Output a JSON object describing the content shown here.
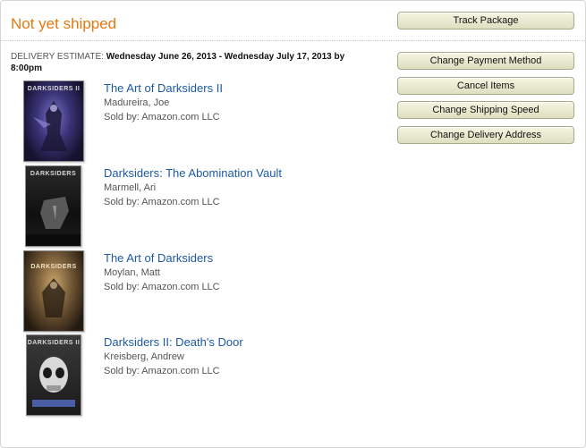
{
  "shipment": {
    "status": "Not yet shipped",
    "estimate_label": "DELIVERY ESTIMATE:",
    "estimate_dates": "Wednesday June 26, 2013 - Wednesday July 17, 2013 by 8:00pm"
  },
  "actions": {
    "track_package": "Track Package",
    "change_payment": "Change Payment Method",
    "cancel_items": "Cancel Items",
    "change_shipping_speed": "Change Shipping Speed",
    "change_delivery_address": "Change Delivery Address"
  },
  "items": [
    {
      "title": "The Art of Darksiders II",
      "author": "Madureira, Joe",
      "seller": "Sold by: Amazon.com LLC",
      "cover_text": "DARKSIDERS II"
    },
    {
      "title": "Darksiders: The Abomination Vault",
      "author": "Marmell, Ari",
      "seller": "Sold by: Amazon.com LLC",
      "cover_text": "DARKSIDERS"
    },
    {
      "title": "The Art of Darksiders",
      "author": "Moylan, Matt",
      "seller": "Sold by: Amazon.com LLC",
      "cover_text": "DARKSIDERS"
    },
    {
      "title": "Darksiders II: Death's Door",
      "author": "Kreisberg, Andrew",
      "seller": "Sold by: Amazon.com LLC",
      "cover_text": "DARKSIDERS II"
    }
  ],
  "colors": {
    "status": "#e47911",
    "title_link": "#1d5aa6",
    "button_top": "#f6f6e2",
    "button_bottom": "#dedec0"
  }
}
